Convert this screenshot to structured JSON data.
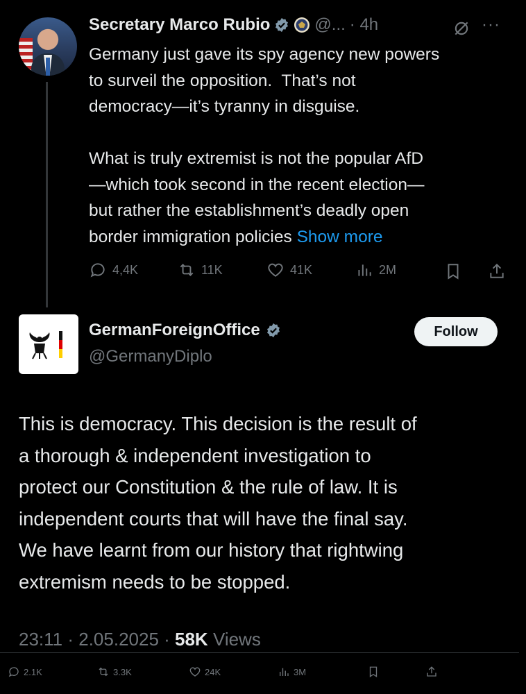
{
  "parent": {
    "author_name": "Secretary Marco Rubio",
    "handle": "@... ",
    "time": "· 4h",
    "text_p1": "Germany just gave its spy agency new powers\nto surveil the opposition.  That’s not\ndemocracy—it’s tyranny in disguise.",
    "text_p2": "What is truly extremist is not the popular AfD\n—which took second in the recent election—\nbut rather the establishment’s deadly open\nborder immigration policies ",
    "show_more": "Show more",
    "replies": "4,4K",
    "reposts": "11K",
    "likes": "41K",
    "views": "2M"
  },
  "reply": {
    "author_name": "GermanForeignOffice",
    "handle": "@GermanyDiplo",
    "follow_label": "Follow",
    "text": "This is democracy. This decision is the result of\na thorough & independent investigation to\nprotect our Constitution & the rule of law. It is\nindependent courts that will have the final say.\nWe have learnt from our history that rightwing\nextremism needs to be stopped.",
    "timestamp": "23:11 · 2.05.2025 · ",
    "views_count": "58K",
    "views_label": " Views",
    "replies": "2.1K",
    "reposts": "3.3K",
    "likes": "24K",
    "views": "3M"
  },
  "colors": {
    "background": "#000000",
    "text": "#e7e9ea",
    "muted": "#71767b",
    "link": "#1d9bf0",
    "verified": "#829aab"
  }
}
